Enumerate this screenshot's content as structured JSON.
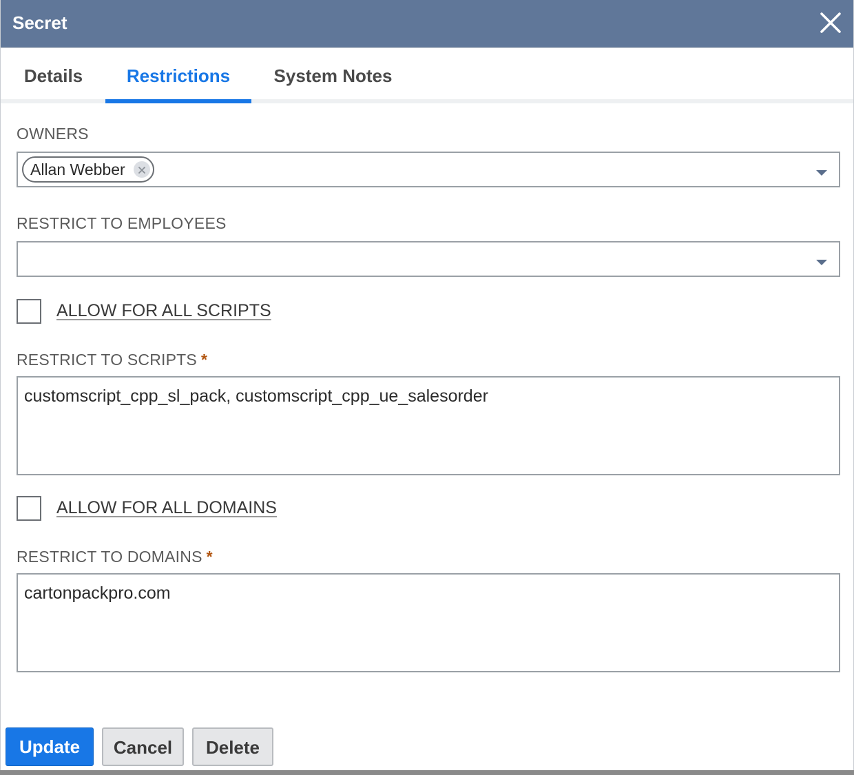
{
  "dialog": {
    "title": "Secret",
    "close_icon": "close-icon"
  },
  "tabs": [
    {
      "label": "Details",
      "active": false
    },
    {
      "label": "Restrictions",
      "active": true
    },
    {
      "label": "System Notes",
      "active": false
    }
  ],
  "owners": {
    "label": "OWNERS",
    "chips": [
      "Allan Webber"
    ]
  },
  "restrict_employees": {
    "label": "RESTRICT TO EMPLOYEES",
    "value": ""
  },
  "allow_all_scripts": {
    "label": "ALLOW FOR ALL SCRIPTS",
    "checked": false
  },
  "restrict_scripts": {
    "label": "RESTRICT TO SCRIPTS",
    "required_mark": "*",
    "value": "customscript_cpp_sl_pack, customscript_cpp_ue_salesorder"
  },
  "allow_all_domains": {
    "label": "ALLOW FOR ALL DOMAINS",
    "checked": false
  },
  "restrict_domains": {
    "label": "RESTRICT TO DOMAINS",
    "required_mark": "*",
    "value": "cartonpackpro.com"
  },
  "buttons": {
    "update": "Update",
    "cancel": "Cancel",
    "delete": "Delete"
  },
  "colors": {
    "titlebar": "#607799",
    "accent": "#1877e6",
    "required": "#b25713"
  }
}
